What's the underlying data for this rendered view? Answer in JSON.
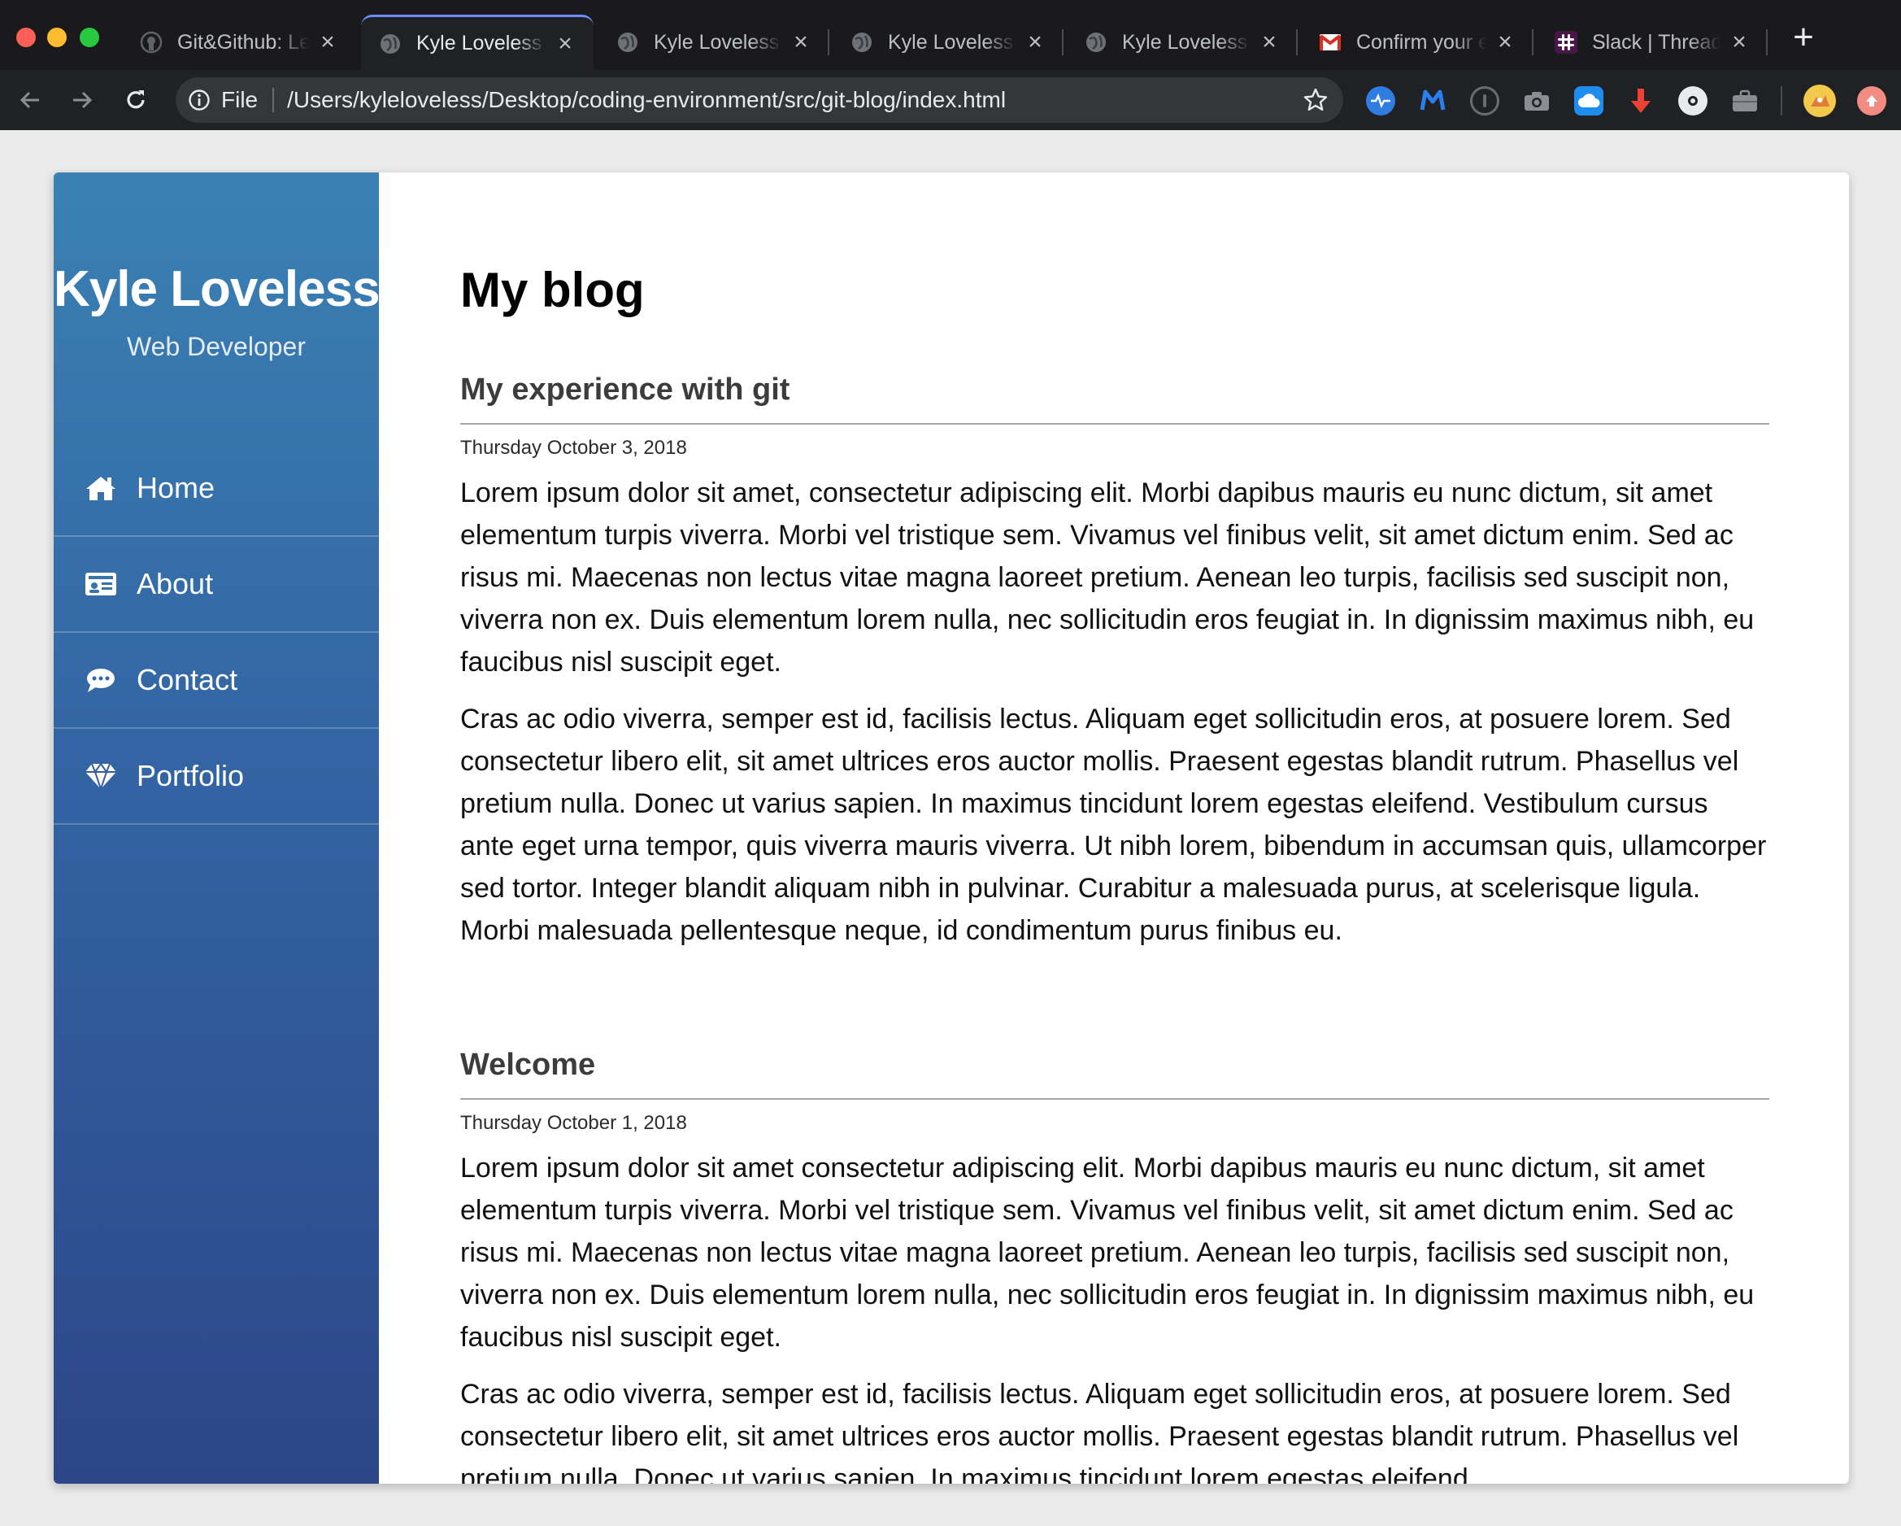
{
  "browser": {
    "tabs": [
      {
        "title": "Git&Github: Learn",
        "favicon": "github-icon",
        "active": false
      },
      {
        "title": "Kyle Loveless - Blog",
        "favicon": "globe-icon",
        "active": true
      },
      {
        "title": "Kyle Loveless - Blog",
        "favicon": "globe-icon",
        "active": false
      },
      {
        "title": "Kyle Loveless - Blog",
        "favicon": "globe-icon",
        "active": false
      },
      {
        "title": "Kyle Loveless - Blog",
        "favicon": "globe-icon",
        "active": false
      },
      {
        "title": "Confirm your email",
        "favicon": "gmail-icon",
        "active": false
      },
      {
        "title": "Slack | Threads",
        "favicon": "slack-icon",
        "active": false
      }
    ],
    "address": {
      "scheme_label": "File",
      "url": "/Users/kyleloveless/Desktop/coding-environment/src/git-blog/index.html"
    },
    "extensions": [
      "activity-icon",
      "malwarebytes-icon",
      "onepassword-icon",
      "camera-icon",
      "cloud-icon",
      "download-arrow-icon",
      "circle-icon",
      "briefcase-icon",
      "profile-avatar",
      "update-icon"
    ],
    "colors": {
      "chrome_bg": "#202124",
      "omnibox_bg": "#35363a",
      "active_tab_accent": "#6b8cff"
    }
  },
  "sidebar": {
    "name": "Kyle Loveless",
    "tagline": "Web Developer",
    "nav": [
      {
        "label": "Home",
        "icon": "home-icon"
      },
      {
        "label": "About",
        "icon": "id-card-icon"
      },
      {
        "label": "Contact",
        "icon": "comment-icon"
      },
      {
        "label": "Portfolio",
        "icon": "diamond-icon"
      }
    ],
    "colors": {
      "gradient_top": "#3a81b4",
      "gradient_bottom": "#2c4689"
    }
  },
  "main": {
    "title": "My blog",
    "posts": [
      {
        "title": "My experience with git",
        "date": "Thursday October 3, 2018",
        "paragraphs": [
          "Lorem ipsum dolor sit amet, consectetur adipiscing elit. Morbi dapibus mauris eu nunc dictum, sit amet elementum turpis viverra. Morbi vel tristique sem. Vivamus vel finibus velit, sit amet dictum enim. Sed ac risus mi. Maecenas non lectus vitae magna laoreet pretium. Aenean leo turpis, facilisis sed suscipit non, viverra non ex. Duis elementum lorem nulla, nec sollicitudin eros feugiat in. In dignissim maximus nibh, eu faucibus nisl suscipit eget.",
          "Cras ac odio viverra, semper est id, facilisis lectus. Aliquam eget sollicitudin eros, at posuere lorem. Sed consectetur libero elit, sit amet ultrices eros auctor mollis. Praesent egestas blandit rutrum. Phasellus vel pretium nulla. Donec ut varius sapien. In maximus tincidunt lorem egestas eleifend. Vestibulum cursus ante eget urna tempor, quis viverra mauris viverra. Ut nibh lorem, bibendum in accumsan quis, ullamcorper sed tortor. Integer blandit aliquam nibh in pulvinar. Curabitur a malesuada purus, at scelerisque ligula. Morbi malesuada pellentesque neque, id condimentum purus finibus eu."
        ]
      },
      {
        "title": "Welcome",
        "date": "Thursday October 1, 2018",
        "paragraphs": [
          "Lorem ipsum dolor sit amet consectetur adipiscing elit. Morbi dapibus mauris eu nunc dictum, sit amet elementum turpis viverra. Morbi vel tristique sem. Vivamus vel finibus velit, sit amet dictum enim. Sed ac risus mi. Maecenas non lectus vitae magna laoreet pretium. Aenean leo turpis, facilisis sed suscipit non, viverra non ex. Duis elementum lorem nulla, nec sollicitudin eros feugiat in. In dignissim maximus nibh, eu faucibus nisl suscipit eget.",
          "Cras ac odio viverra, semper est id, facilisis lectus. Aliquam eget sollicitudin eros, at posuere lorem. Sed consectetur libero elit, sit amet ultrices eros auctor mollis. Praesent egestas blandit rutrum. Phasellus vel pretium nulla. Donec ut varius sapien. In maximus tincidunt lorem egestas eleifend."
        ]
      }
    ]
  }
}
